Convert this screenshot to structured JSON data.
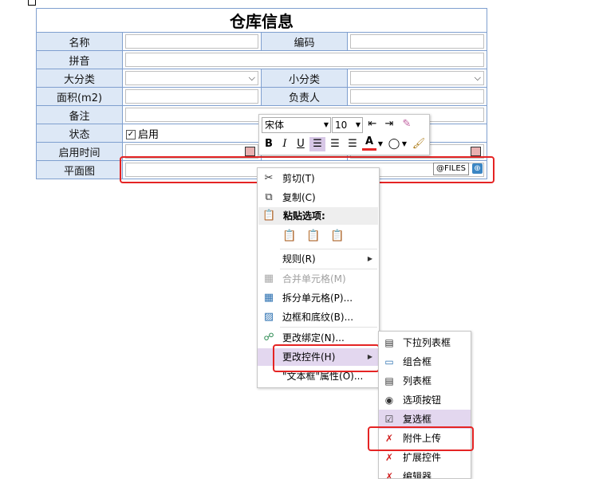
{
  "form": {
    "title": "仓库信息",
    "rows": {
      "name_label": "名称",
      "code_label": "编码",
      "pinyin_label": "拼音",
      "category_label": "大分类",
      "subcategory_label": "小分类",
      "area_label": "面积(m2)",
      "manager_label": "负责人",
      "remark_label": "备注",
      "status_label": "状态",
      "status_checkbox_label": "启用",
      "enable_time_label": "启用时间",
      "floorplan_label": "平面图",
      "files_button": "@FILES"
    }
  },
  "minitoolbar": {
    "font_name": "宋体",
    "font_size": "10",
    "bold": "B",
    "italic": "I",
    "underline": "U",
    "font_color_glyph": "A"
  },
  "context_menu": {
    "cut": "剪切(T)",
    "copy": "复制(C)",
    "paste_options": "粘贴选项:",
    "rules": "规则(R)",
    "merge_cells": "合并单元格(M)",
    "split_cells": "拆分单元格(P)...",
    "borders": "边框和底纹(B)...",
    "change_binding": "更改绑定(N)...",
    "change_control": "更改控件(H)",
    "textbox_props": "\"文本框\"属性(O)..."
  },
  "submenu": {
    "items": [
      "下拉列表框",
      "组合框",
      "列表框",
      "选项按钮",
      "复选框",
      "附件上传",
      "扩展控件",
      "编辑器"
    ]
  },
  "colors": {
    "label_bg": "#dde8f6",
    "border": "#7f9fcf",
    "highlight_red": "#e52424",
    "menu_hover": "#e3d7ef"
  }
}
